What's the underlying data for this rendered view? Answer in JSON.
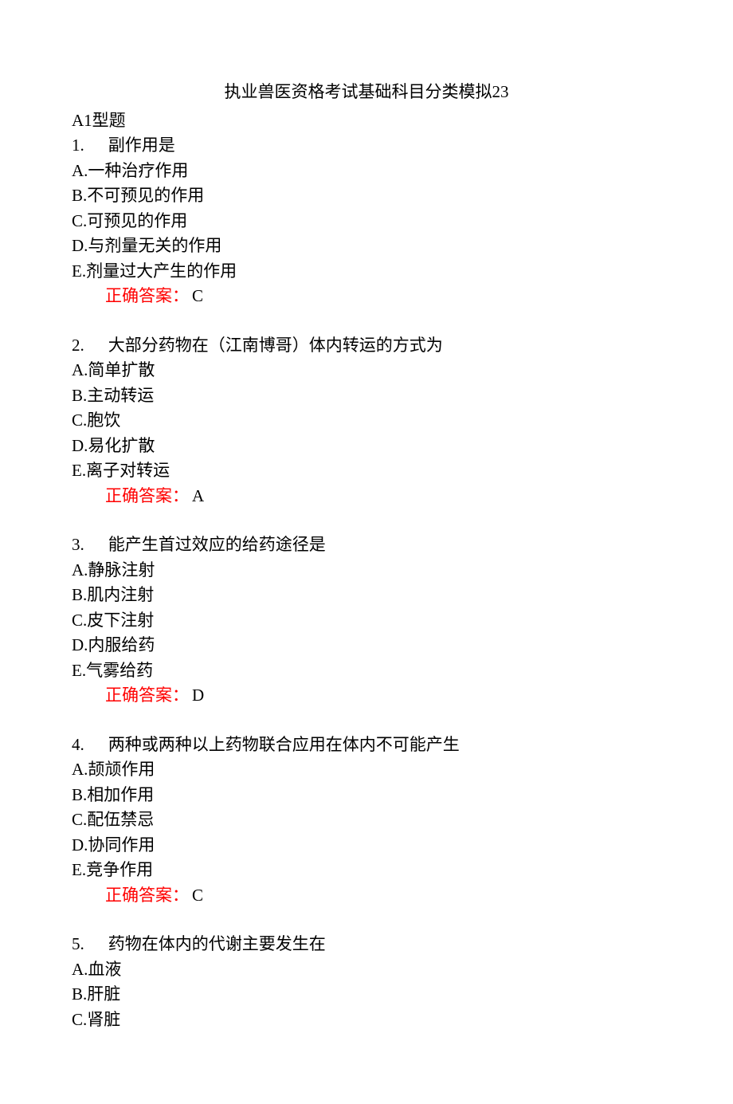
{
  "title": "执业兽医资格考试基础科目分类模拟23",
  "section_header": "A1型题",
  "answer_label": "正确答案：",
  "questions": [
    {
      "num": "1.",
      "stem": "副作用是",
      "options": {
        "A": "A.一种治疗作用",
        "B": "B.不可预见的作用",
        "C": "C.可预见的作用",
        "D": "D.与剂量无关的作用",
        "E": "E.剂量过大产生的作用"
      },
      "answer": "C"
    },
    {
      "num": "2.",
      "stem": "大部分药物在（江南博哥）体内转运的方式为",
      "options": {
        "A": "A.简单扩散",
        "B": "B.主动转运",
        "C": "C.胞饮",
        "D": "D.易化扩散",
        "E": "E.离子对转运"
      },
      "answer": "A"
    },
    {
      "num": "3.",
      "stem": "能产生首过效应的给药途径是",
      "options": {
        "A": "A.静脉注射",
        "B": "B.肌内注射",
        "C": "C.皮下注射",
        "D": "D.内服给药",
        "E": "E.气雾给药"
      },
      "answer": "D"
    },
    {
      "num": "4.",
      "stem": "两种或两种以上药物联合应用在体内不可能产生",
      "options": {
        "A": "A.颉颃作用",
        "B": "B.相加作用",
        "C": "C.配伍禁忌",
        "D": "D.协同作用",
        "E": "E.竞争作用"
      },
      "answer": "C"
    },
    {
      "num": "5.",
      "stem": "药物在体内的代谢主要发生在",
      "options": {
        "A": "A.血液",
        "B": "B.肝脏",
        "C": "C.肾脏"
      },
      "answer": null
    }
  ]
}
